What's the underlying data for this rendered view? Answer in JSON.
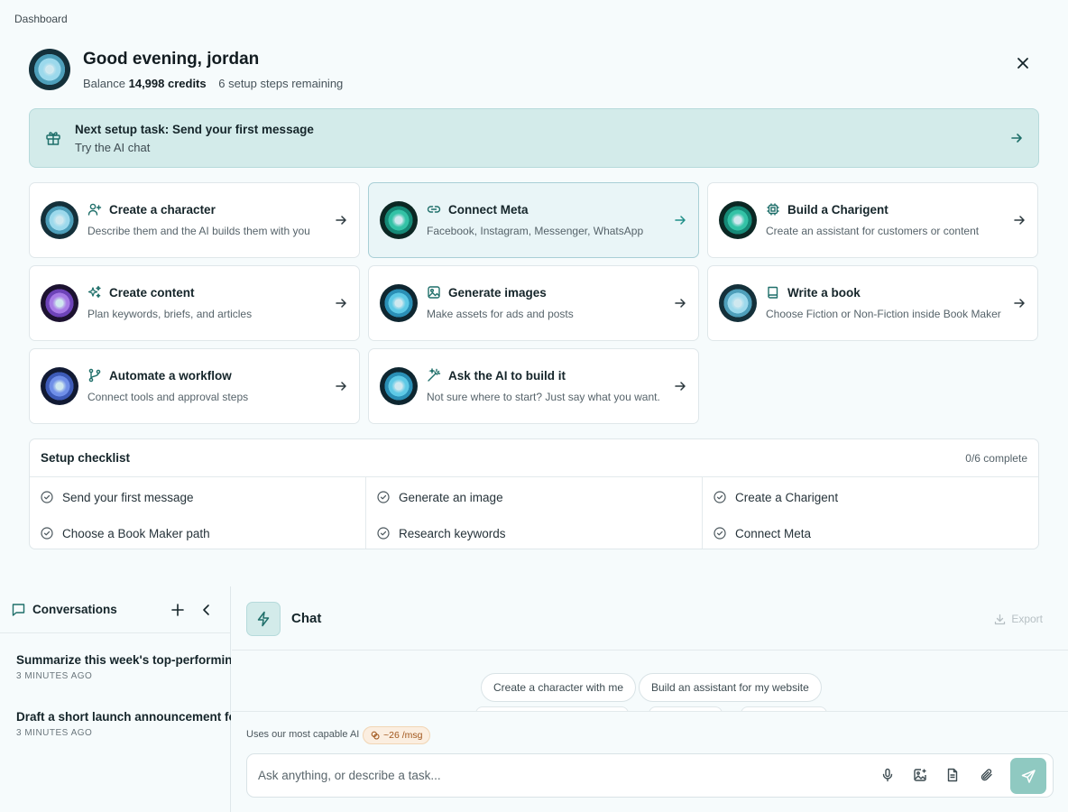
{
  "breadcrumb": "Dashboard",
  "header": {
    "greeting": "Good evening, jordan",
    "balance_label": "Balance",
    "balance_value": "14,998 credits",
    "steps_remaining": "6 setup steps remaining"
  },
  "banner": {
    "title": "Next setup task: Send your first message",
    "subtitle": "Try the AI chat"
  },
  "cards": [
    {
      "title": "Create a character",
      "desc": "Describe them and the AI builds them with you",
      "icon": "user-plus-icon"
    },
    {
      "title": "Connect Meta",
      "desc": "Facebook, Instagram, Messenger, WhatsApp",
      "icon": "link-icon"
    },
    {
      "title": "Build a Charigent",
      "desc": "Create an assistant for customers or content",
      "icon": "chip-icon"
    },
    {
      "title": "Create content",
      "desc": "Plan keywords, briefs, and articles",
      "icon": "sparkles-icon"
    },
    {
      "title": "Generate images",
      "desc": "Make assets for ads and posts",
      "icon": "image-icon"
    },
    {
      "title": "Write a book",
      "desc": "Choose Fiction or Non-Fiction inside Book Maker",
      "icon": "book-icon"
    },
    {
      "title": "Automate a workflow",
      "desc": "Connect tools and approval steps",
      "icon": "branch-icon"
    },
    {
      "title": "Ask the AI to build it",
      "desc": "Not sure where to start? Just say what you want.",
      "icon": "wand-icon"
    }
  ],
  "checklist": {
    "title": "Setup checklist",
    "count": "0/6 complete",
    "items": [
      "Send your first message",
      "Choose a Book Maker path",
      "Generate an image",
      "Research keywords",
      "Create a Charigent",
      "Connect Meta"
    ]
  },
  "sidebar": {
    "title": "Conversations",
    "conversations": [
      {
        "title": "Summarize this week's top-performing",
        "time": "3 MINUTES AGO"
      },
      {
        "title": "Draft a short launch announcement fo",
        "time": "3 MINUTES AGO"
      }
    ]
  },
  "chat": {
    "title": "Chat",
    "export_label": "Export",
    "suggestions": [
      "Create a character with me",
      "Build an assistant for my website"
    ],
    "model_note": "Uses our most capable AI",
    "cost": "~26 /msg",
    "input_placeholder": "Ask anything, or describe a task..."
  },
  "colors": {
    "accent": "#1f8f88",
    "banner_bg": "#d3ebea",
    "send_bg": "#8fc9c1"
  }
}
